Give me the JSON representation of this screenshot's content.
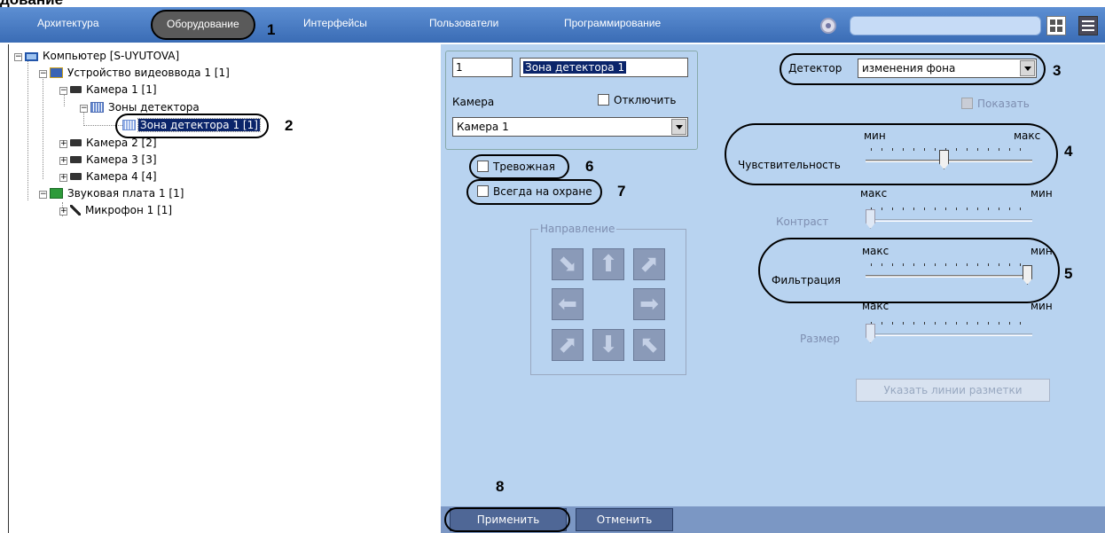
{
  "clipped_text": "дование",
  "tabs": [
    {
      "label": "Архитектура"
    },
    {
      "label": "Оборудование"
    },
    {
      "label": "Интерфейсы"
    },
    {
      "label": "Пользователи"
    },
    {
      "label": "Программирование"
    }
  ],
  "active_tab": "Оборудование",
  "top_search": {
    "value": ""
  },
  "tree": [
    {
      "label": "Компьютер [S-UYUTOVA]",
      "icon": "computer-icon",
      "depth": 0,
      "expanded": true
    },
    {
      "label": "Устройство видеоввода 1 [1]",
      "icon": "video-device-icon",
      "depth": 1,
      "expanded": true
    },
    {
      "label": "Камера 1 [1]",
      "icon": "camera-icon",
      "depth": 2,
      "expanded": true
    },
    {
      "label": "Зоны детектора",
      "icon": "detector-zones-icon",
      "depth": 3,
      "expanded": true
    },
    {
      "label": "Зона детектора 1 [1]",
      "icon": "detector-zone-icon",
      "depth": 4,
      "selected": true
    },
    {
      "label": "Камера 2 [2]",
      "icon": "camera-icon",
      "depth": 2,
      "expanded": false
    },
    {
      "label": "Камера 3 [3]",
      "icon": "camera-icon",
      "depth": 2,
      "expanded": false
    },
    {
      "label": "Камера 4 [4]",
      "icon": "camera-icon",
      "depth": 2,
      "expanded": false
    },
    {
      "label": "Звуковая плата 1 [1]",
      "icon": "sound-card-icon",
      "depth": 1,
      "expanded": true
    },
    {
      "label": "Микрофон 1 [1]",
      "icon": "microphone-icon",
      "depth": 2,
      "expanded": false
    }
  ],
  "zone": {
    "id": "1",
    "name": "Зона детектора 1",
    "camera_label": "Камера",
    "disable_label": "Отключить",
    "camera_value": "Камера 1"
  },
  "checkboxes": {
    "alarm": "Тревожная",
    "always_armed": "Всегда на охране"
  },
  "direction": {
    "title": "Направление",
    "arrows": [
      "arrow-down-right",
      "arrow-up",
      "arrow-up-right",
      "arrow-left",
      "arrow-right",
      "arrow-up-right",
      "arrow-down",
      "arrow-up-left"
    ]
  },
  "detector": {
    "label": "Детектор",
    "value": "изменения фона",
    "show_label": "Показать"
  },
  "sliders": {
    "sensitivity": {
      "label": "Чувствительность",
      "left": "мин",
      "right": "макс",
      "level": 0.47
    },
    "contrast": {
      "label": "Контраст",
      "left": "макс",
      "right": "мин",
      "level": 0.0
    },
    "filtration": {
      "label": "Фильтрация",
      "left": "макс",
      "right": "мин",
      "level": 1.0
    },
    "size": {
      "label": "Размер",
      "left": "макс",
      "right": "мин",
      "level": 0.0
    }
  },
  "markup_button": "Указать линии разметки",
  "buttons": {
    "apply": "Применить",
    "cancel": "Отменить"
  },
  "callout_numbers": [
    "1",
    "2",
    "3",
    "4",
    "5",
    "6",
    "7",
    "8"
  ],
  "colors": {
    "top_bar": "#4a7cc4",
    "panel": "#b8d3f0",
    "selection": "#0a246a",
    "bottom_bar": "#7b97c4"
  }
}
